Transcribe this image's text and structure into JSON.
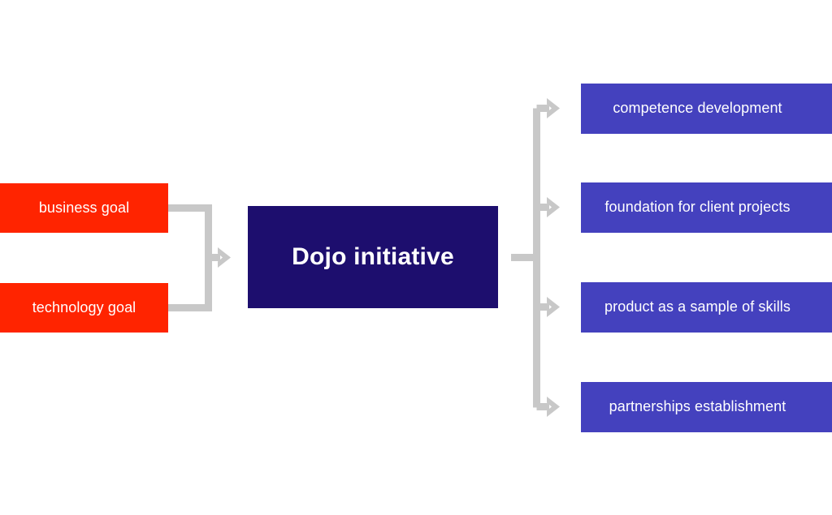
{
  "diagram": {
    "title": "Dojo initiative",
    "palette": {
      "background": "#ffffff",
      "input_node": "#FF2400",
      "center_node": "#1D0E6E",
      "outcome_node": "#4441BE",
      "connector": "#C8C8C8",
      "node_text": "#ffffff"
    },
    "inputs": [
      {
        "label": "business goal"
      },
      {
        "label": "technology goal"
      }
    ],
    "center": {
      "label": "Dojo initiative"
    },
    "outcomes": [
      {
        "label": "competence development"
      },
      {
        "label": "foundation for client projects"
      },
      {
        "label": "product as a sample of skills"
      },
      {
        "label": "partnerships establishment"
      }
    ]
  }
}
